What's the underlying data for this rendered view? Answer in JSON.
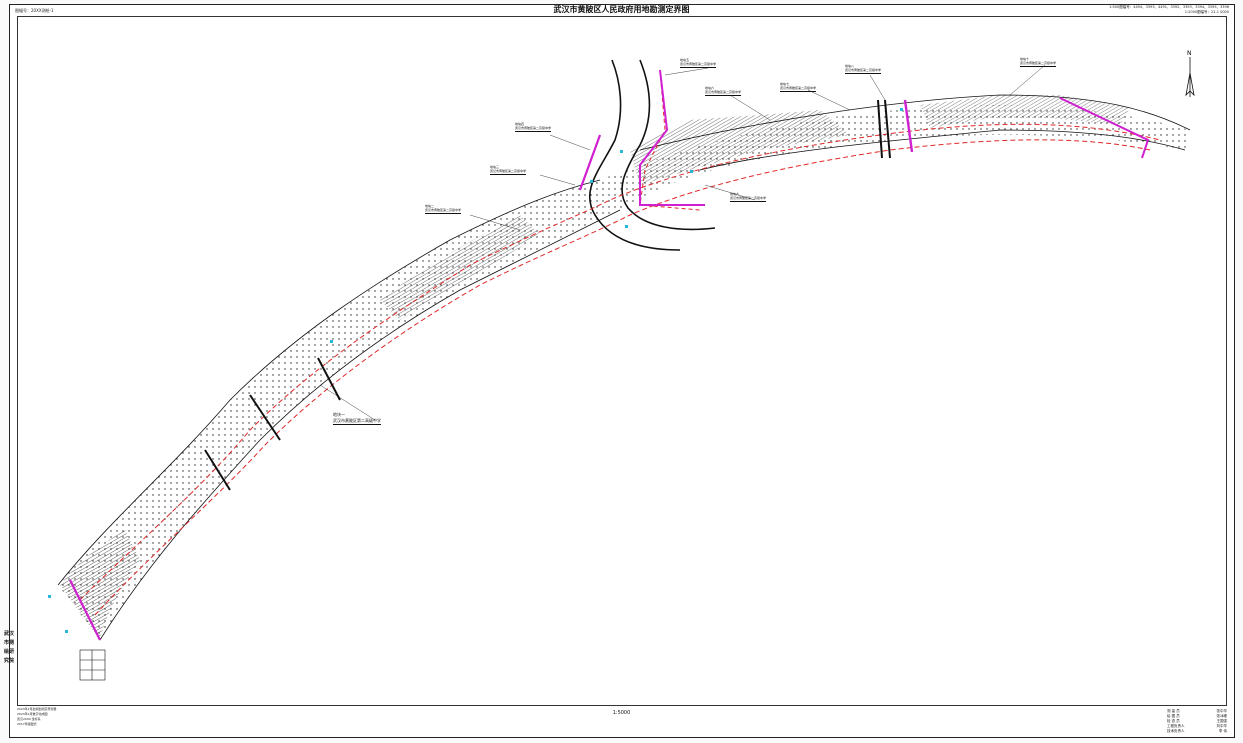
{
  "map": {
    "title": "武汉市黄陂区人民政府用地勘测定界图",
    "sheet_number": "图幅号：20XX测绘-1",
    "top_right_lines": [
      "1:500图幅号：4494、3393、4491、3392、3393、3394、3395、3396",
      "1:2000图幅号：21-1 0000"
    ],
    "scale": "1:5000",
    "institute_vertical": "武汉市测绘研究院",
    "notes": [
      "2023年2月勘测勘测定界测量",
      "2023年2月数字化成图",
      "武汉2000 坐标系",
      "2017年版图式"
    ],
    "signatures": [
      {
        "role": "测  量  员",
        "name": "张中华"
      },
      {
        "role": "绘  图  员",
        "name": "张冰峰"
      },
      {
        "role": "检  查  员",
        "name": "王国强"
      },
      {
        "role": "工程负责人",
        "name": "刘中华"
      },
      {
        "role": "技术负责人",
        "name": "李  伟"
      }
    ],
    "north_label": "N",
    "colors": {
      "boundary": "#e02828",
      "highlight": "#d020d0",
      "marker": "#27b7d8",
      "linework": "#111111"
    },
    "parcel_labels": [
      {
        "id": "地块一",
        "owner": "武汉市黄陂区第二高级中学"
      },
      {
        "id": "地块二",
        "owner": "武汉市黄陂区第二高级中学"
      },
      {
        "id": "地块三",
        "owner": "武汉市黄陂区第二高级中学"
      },
      {
        "id": "地块四",
        "owner": "武汉市黄陂区第二高级中学"
      },
      {
        "id": "地块五",
        "owner": "武汉市黄陂区第二高级中学"
      },
      {
        "id": "地块六",
        "owner": "武汉市黄陂区第二高级中学"
      },
      {
        "id": "地块七",
        "owner": "武汉市黄陂区第二高级中学"
      },
      {
        "id": "地块八",
        "owner": "武汉市黄陂区第二高级中学"
      },
      {
        "id": "地块九",
        "owner": "武汉市黄陂区第二高级中学"
      },
      {
        "id": "地块十",
        "owner": "武汉市黄陂区第二高级中学"
      }
    ]
  }
}
